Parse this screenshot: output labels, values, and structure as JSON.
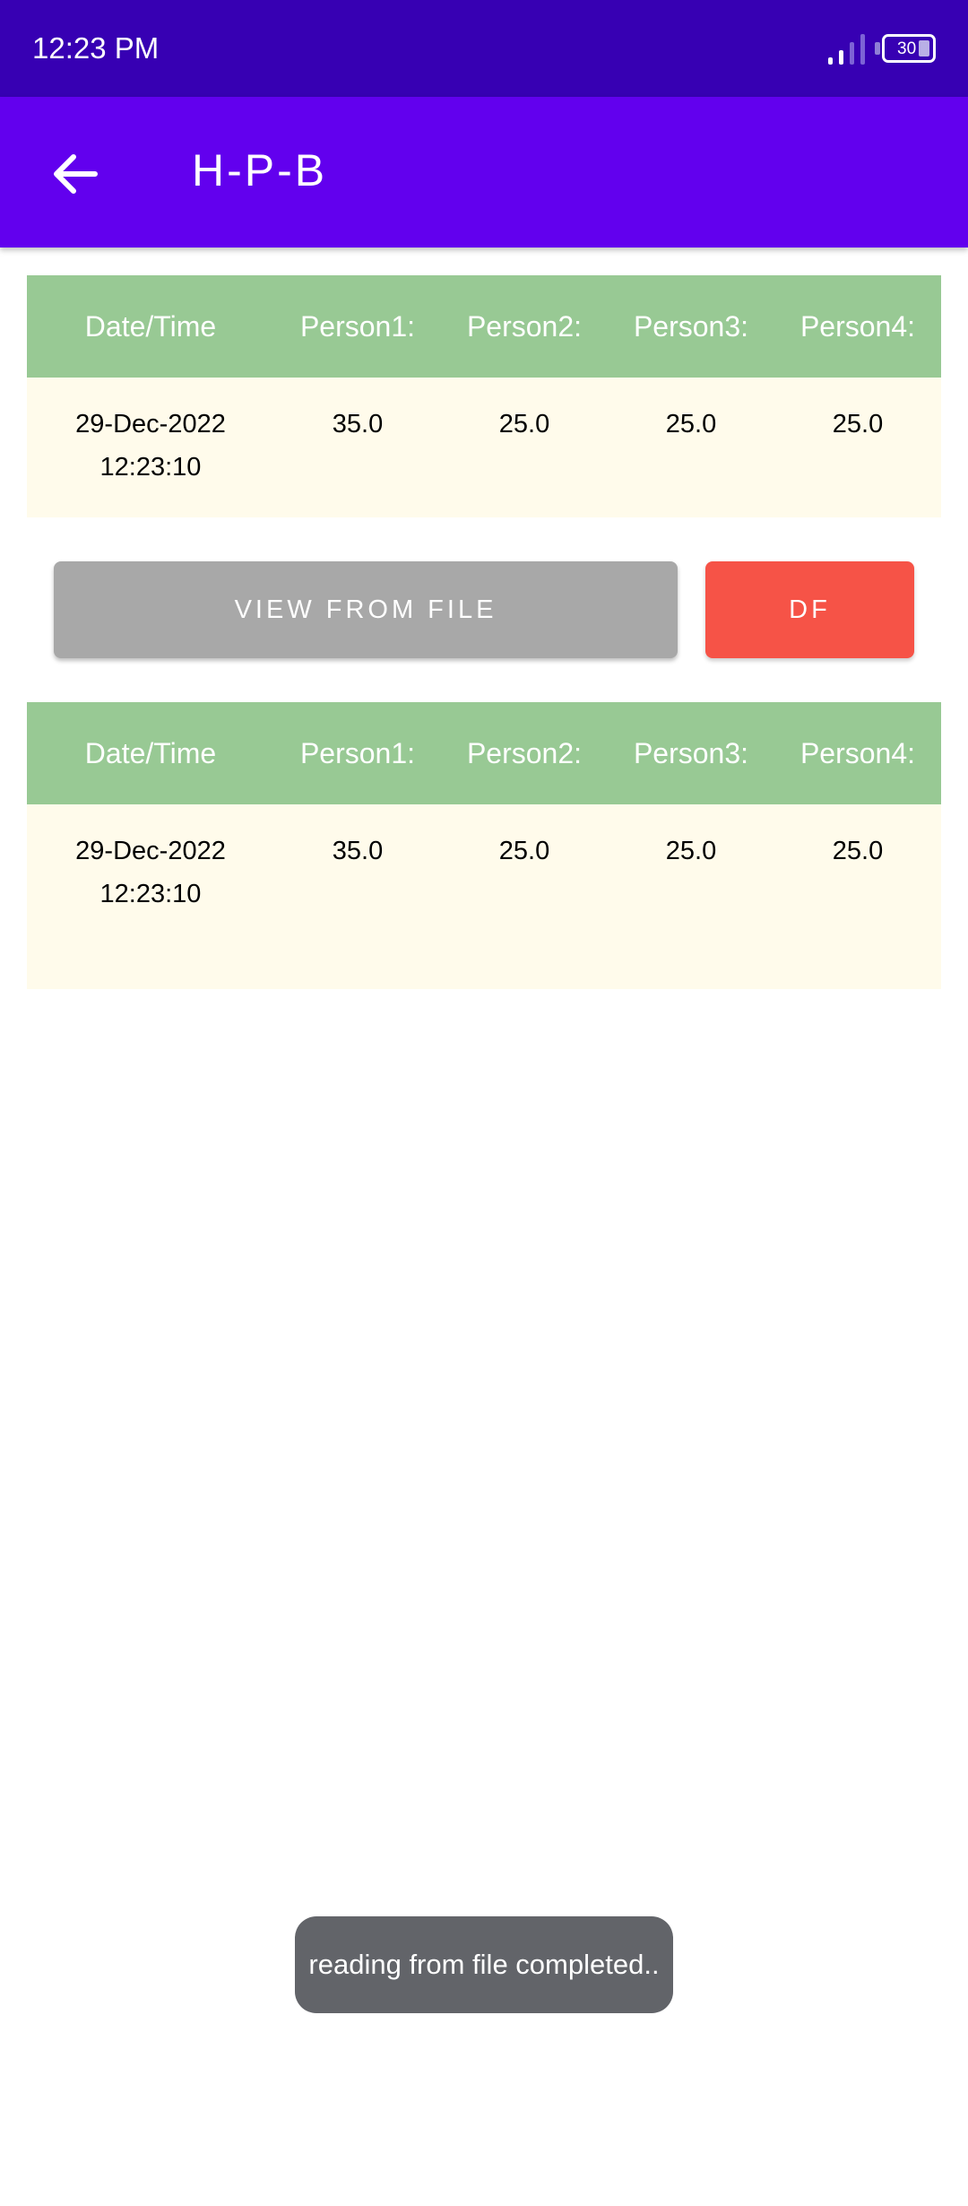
{
  "status_bar": {
    "time": "12:23 PM",
    "battery": "30",
    "icons": [
      "signal-icon",
      "battery-icon"
    ]
  },
  "app_bar": {
    "title": "H-P-B",
    "back_icon": "arrow-back-icon"
  },
  "table1": {
    "headers": [
      "Date/Time",
      "Person1:",
      "Person2:",
      "Person3:",
      "Person4:"
    ],
    "rows": [
      {
        "date": "29-Dec-2022",
        "time": "12:23:10",
        "p1": "35.0",
        "p2": "25.0",
        "p3": "25.0",
        "p4": "25.0"
      }
    ]
  },
  "buttons": {
    "view_label": "VIEW FROM FILE",
    "df_label": "DF"
  },
  "table2": {
    "headers": [
      "Date/Time",
      "Person1:",
      "Person2:",
      "Person3:",
      "Person4:"
    ],
    "rows": [
      {
        "date": "29-Dec-2022",
        "time": "12:23:10",
        "p1": "35.0",
        "p2": "25.0",
        "p3": "25.0",
        "p4": "25.0"
      }
    ]
  },
  "toast": {
    "message": "reading from file completed.."
  },
  "colors": {
    "status_bar": "#3700b3",
    "app_bar": "#6200ee",
    "table_header": "#98c994",
    "table_body": "#fffbeb",
    "view_button": "#a8a8a8",
    "df_button": "#f65347",
    "toast": "#626469"
  }
}
